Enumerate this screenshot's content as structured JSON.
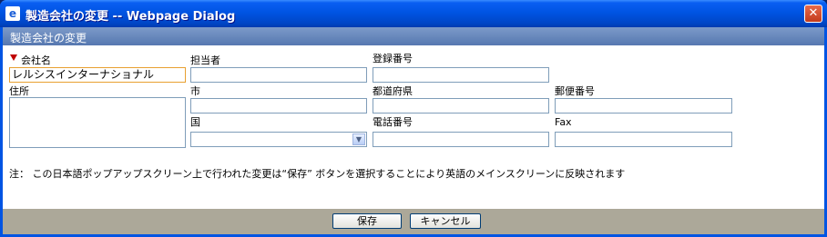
{
  "window": {
    "title": "製造会社の変更 -- Webpage Dialog",
    "icon": "ie-page-icon",
    "close_glyph": "✕"
  },
  "section": {
    "header": "製造会社の変更"
  },
  "form": {
    "company_name": {
      "label": "会社名",
      "value": "レルシスインターナショナル"
    },
    "contact": {
      "label": "担当者",
      "value": ""
    },
    "registration_no": {
      "label": "登録番号",
      "value": ""
    },
    "address": {
      "label": "住所",
      "value": ""
    },
    "city": {
      "label": "市",
      "value": ""
    },
    "prefecture": {
      "label": "都道府県",
      "value": ""
    },
    "postal_code": {
      "label": "郵便番号",
      "value": ""
    },
    "country": {
      "label": "国",
      "value": ""
    },
    "phone": {
      "label": "電話番号",
      "value": ""
    },
    "fax": {
      "label": "Fax",
      "value": ""
    }
  },
  "note": "注：  この日本語ポップアップスクリーン上で行われた変更は“保存” ボタンを選択することにより英語のメインスクリーンに反映されます",
  "buttons": {
    "save": "保存",
    "cancel": "キャンセル"
  },
  "colors": {
    "titlebar": "#0054e3",
    "section_header": "#6787bd",
    "footer": "#aca899",
    "required_marker": "#c00000"
  }
}
